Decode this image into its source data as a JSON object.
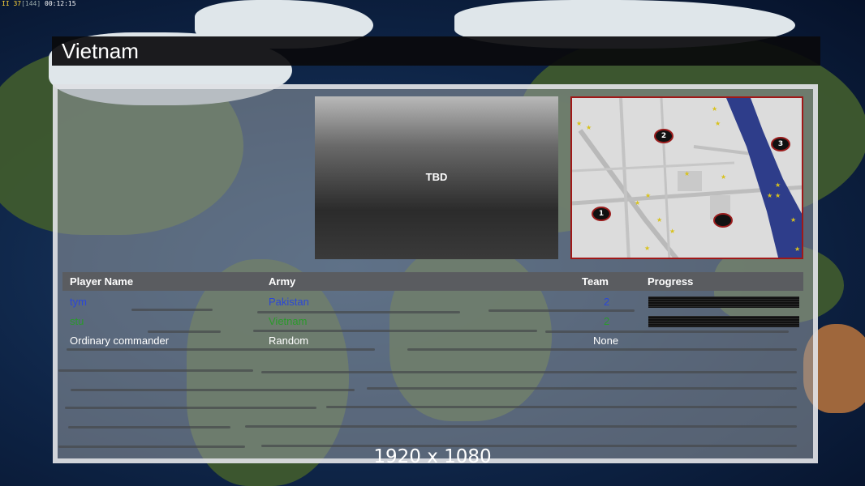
{
  "debug": {
    "fps": "37",
    "frames": "[144]",
    "clock": "00:12:15"
  },
  "map_title": "Vietnam",
  "preview": {
    "text": "TBD"
  },
  "minimap": {
    "start_positions": [
      "1",
      "2",
      "3",
      ""
    ]
  },
  "table": {
    "headers": {
      "player": "Player Name",
      "army": "Army",
      "team": "Team",
      "progress": "Progress"
    },
    "rows": [
      {
        "player": "tym",
        "army": "Pakistan",
        "team": "2",
        "color": "#2b47d6",
        "progress": 1.0
      },
      {
        "player": "stu",
        "army": "Vietnam",
        "team": "2",
        "color": "#2a9a2a",
        "progress": 1.0
      },
      {
        "player": "Ordinary commander",
        "army": "Random",
        "team": "None",
        "color": "#ffffff",
        "progress": null
      }
    ]
  },
  "resolution": "1920 x 1080"
}
